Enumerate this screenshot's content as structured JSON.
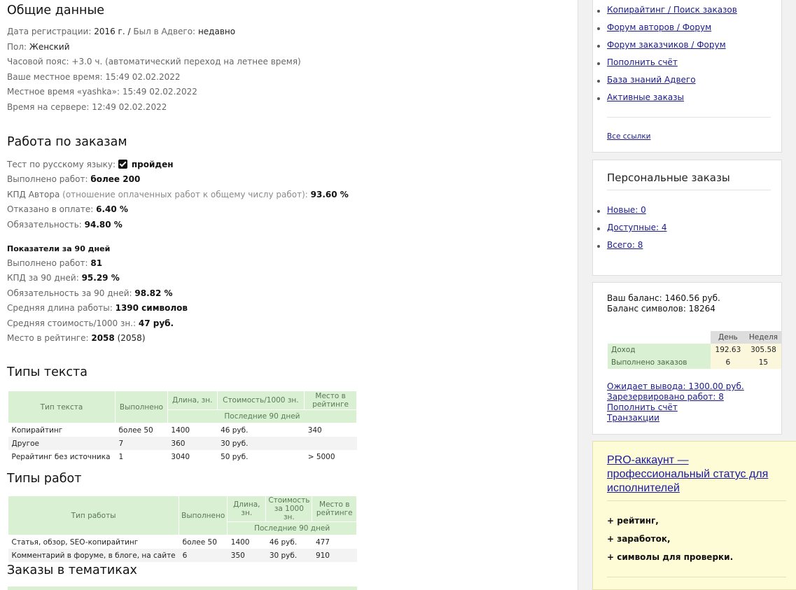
{
  "general": {
    "title": "Общие данные",
    "reg_label": "Дата регистрации:",
    "reg_value": "2016 г.",
    "sep": "/",
    "visited_label": "Был в Адвего:",
    "visited_value": "недавно",
    "gender_label": "Пол:",
    "gender_value": "Женский",
    "tz": "Часовой пояс: +3.0 ч. (автоматический переход на летнее время)",
    "local_time": "Ваше местное время: 15:49 02.02.2022",
    "user_time": "Местное время «yashka»: 15:49 02.02.2022",
    "server_time": "Время на сервере: 12:49 02.02.2022"
  },
  "orders": {
    "title": "Работа по заказам",
    "test_label": "Тест по русскому языку:",
    "test_value": "пройден",
    "done_label": "Выполнено работ:",
    "done_value": "более 200",
    "kpd_label": "КПД Автора",
    "kpd_note": "(отношение оплаченных работ к общему числу работ):",
    "kpd_value": "93.60 %",
    "refused_label": "Отказано в оплате:",
    "refused_value": "6.40 %",
    "oblig_label": "Обязательность:",
    "oblig_value": "94.80 %"
  },
  "stats90": {
    "title": "Показатели за 90 дней",
    "done_label": "Выполнено работ:",
    "done_value": "81",
    "kpd_label": "КПД за 90 дней:",
    "kpd_value": "95.29 %",
    "oblig_label": "Обязательность за 90 дней:",
    "oblig_value": "98.82 %",
    "len_label": "Средняя длина работы:",
    "len_value": "1390 символов",
    "cost_label": "Средняя стоимость/1000 зн.:",
    "cost_value": "47 руб.",
    "rank_label": "Место в рейтинге:",
    "rank_value": "2058",
    "rank_extra": "(2058)"
  },
  "text_types": {
    "title": "Типы текста",
    "headers": [
      "Тип текста",
      "Выполнено",
      "Длина, зн.",
      "Стоимость/1000 зн.",
      "Место в рейтинге",
      "Последние 90 дней"
    ],
    "rows": [
      [
        "Копирайтинг",
        "более 50",
        "1400",
        "46 руб.",
        "340"
      ],
      [
        "Другое",
        "7",
        "360",
        "30 руб.",
        ""
      ],
      [
        "Рерайтинг без источника",
        "1",
        "3040",
        "50 руб.",
        "> 5000"
      ]
    ]
  },
  "work_types": {
    "title": "Типы работ",
    "headers": [
      "Тип работы",
      "Выполнено",
      "Длина, зн.",
      "Стоимость за 1000 зн.",
      "Место в рейтинге",
      "Последние 90 дней"
    ],
    "rows": [
      [
        "Статья, обзор, SEO-копирайтинг",
        "более 50",
        "1400",
        "46 руб.",
        "477"
      ],
      [
        "Комментарий в форуме, в блоге, на сайте",
        "6",
        "350",
        "30 руб.",
        "910"
      ]
    ]
  },
  "topics": {
    "title": "Заказы в тематиках"
  },
  "sidebar": {
    "links": [
      "Копирайтинг / Поиск заказов",
      "Форум авторов / Форум",
      "Форум заказчиков / Форум",
      "Пополнить счёт",
      "База знаний Адвего",
      "Активные заказы"
    ],
    "all_links": "Все ссылки",
    "personal_title": "Персональные заказы",
    "personal": [
      "Новые: 0",
      "Доступные: 4",
      "Всего: 8"
    ],
    "balance": "Ваш баланс: 1460.56 руб.",
    "symbols": "Баланс символов: 18264",
    "mini_headers": [
      "День",
      "Неделя"
    ],
    "mini_rows": [
      [
        "Доход",
        "192.63",
        "305.58"
      ],
      [
        "Выполнено заказов",
        "6",
        "15"
      ]
    ],
    "wait": "Ожидает вывода: 1300.00 руб.",
    "reserved": "Зарезервировано работ: 8",
    "topup": "Пополнить счёт",
    "transactions": "Транзакции",
    "pro_title": "PRO-аккаунт — профессиональный статус для исполнителей",
    "pro_items": [
      "+ рейтинг,",
      "+ заработок,",
      "+ символы для проверки."
    ]
  }
}
